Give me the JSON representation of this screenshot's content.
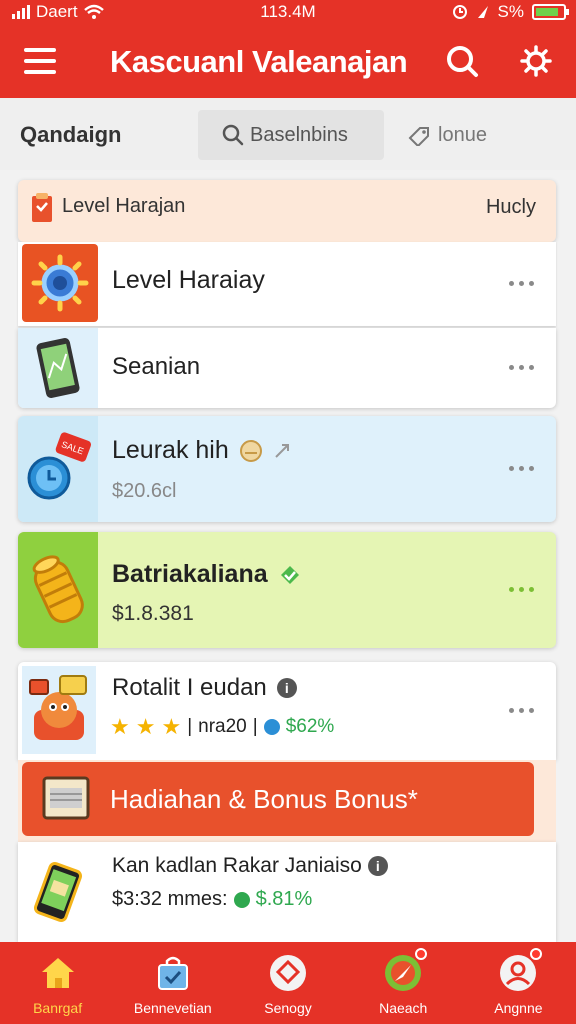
{
  "status": {
    "carrier": "Daert",
    "time": "113.4M",
    "battery": "S%"
  },
  "appbar": {
    "title": "Kascuanl Valeanajan"
  },
  "tabs": [
    {
      "label": "Qandaign"
    },
    {
      "label": "Baselnbins"
    },
    {
      "label": "lonue"
    }
  ],
  "list": {
    "header": {
      "label": "Level Harajan",
      "right": "Hucly"
    },
    "items": [
      {
        "name": "Level Haraiay",
        "icon": "gear-badge-icon"
      },
      {
        "name": "Seanian",
        "icon": "phone-map-icon"
      },
      {
        "name": "Leurak hih",
        "price": "$20.6cl",
        "icon": "clock-tag-icon"
      },
      {
        "name": "Batriakaliana",
        "price": "$1.8.381",
        "icon": "coin-stack-icon"
      },
      {
        "name": "Rotalit I eudan",
        "rating_text": "nra20",
        "discount": "$62%",
        "rating": 3,
        "icon": "cartoon-character-icon"
      },
      {
        "name": "Kan kadlan Rakar Janiaiso",
        "price": "$3:32 mmes:",
        "discount": "$.81%",
        "icon": "phone-card-icon"
      }
    ]
  },
  "promo": {
    "text": "Hadiahan & Bonus Bonus*"
  },
  "bottomnav": [
    {
      "label": "Banrgaf",
      "icon": "home-icon",
      "active": true
    },
    {
      "label": "Bennevetian",
      "icon": "shopping-bag-icon"
    },
    {
      "label": "Senogy",
      "icon": "chat-icon"
    },
    {
      "label": "Naeach",
      "icon": "compass-icon"
    },
    {
      "label": "Angnne",
      "icon": "profile-icon"
    }
  ],
  "colors": {
    "primary": "#e53227",
    "promo": "#e8512c",
    "highlight_green": "#e5f5b4",
    "highlight_blue": "#dff1fb"
  }
}
